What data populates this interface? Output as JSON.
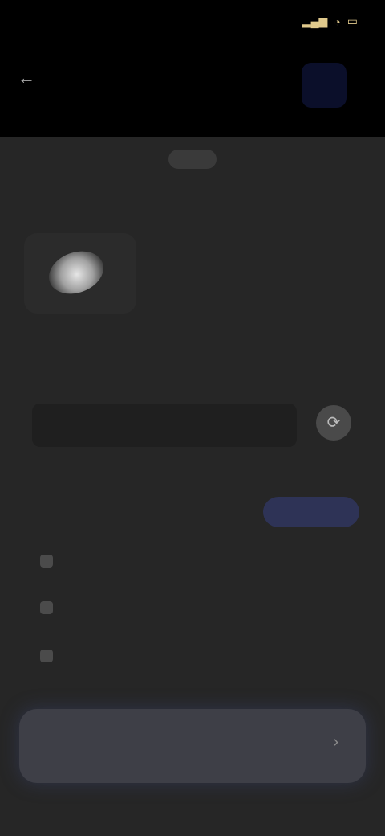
{
  "status": {
    "time": "",
    "icons": [
      "signal-icon",
      "wifi-icon",
      "battery-icon"
    ]
  },
  "header": {
    "back_glyph": "←",
    "title": "",
    "accent_gold": "#d8c79a"
  },
  "sheet": {
    "handle_label": "",
    "section_title": "",
    "preview_alt": "",
    "field_label": "",
    "field_placeholder": "",
    "field_icon_glyph": "⟳",
    "list_header": "",
    "chip_label": "",
    "list": [
      {
        "text": "",
        "tag": ""
      },
      {
        "text": "",
        "tag": ""
      },
      {
        "text": "",
        "tag": ""
      }
    ],
    "cta": {
      "label": "",
      "arrow_glyph": "›"
    },
    "colors": {
      "chip_bg": "#2e3356",
      "cta_bg": "#3e3f47"
    }
  }
}
